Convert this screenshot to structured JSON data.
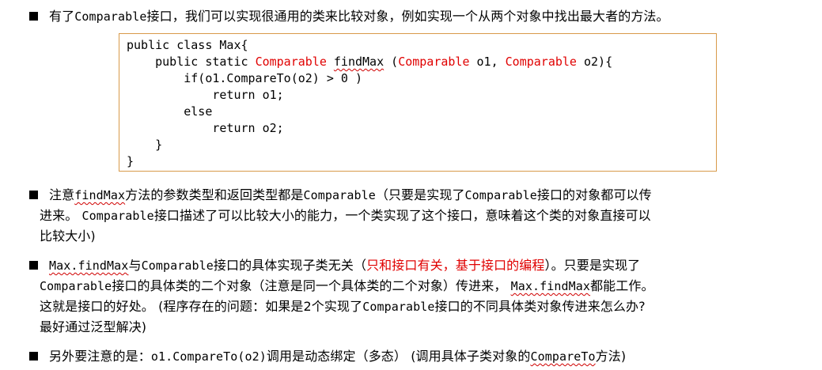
{
  "bullets": [
    {
      "line1_pre": "有了",
      "line1_code": "Comparable",
      "line1_post": "接口，我们可以实现很通用的类来比较对象，例如实现一个从两个对象中找出最大者的方法。"
    },
    {
      "line1_a": "注意",
      "line1_code1": "findMax",
      "line1_b": "方法的参数类型和返回类型都是",
      "line1_code2": "Comparable",
      "line1_c": "（只要是实现了",
      "line1_code3": "Comparable",
      "line1_d": "接口的对象都可以传",
      "line2_a": "进来。 ",
      "line2_code": "Comparable",
      "line2_b": "接口描述了可以比较大小的能力，一个类实现了这个接口，意味着这个类的对象直接可以",
      "line3": "比较大小)"
    },
    {
      "line1_code1": "Max.findMax",
      "line1_a": "与",
      "line1_code2": "Comparable",
      "line1_b": "接口的具体实现子类无关（",
      "line1_red": "只和接口有关，基于接口的编程",
      "line1_c": "）。只要是实现了",
      "line2_code1": "Comparable",
      "line2_a": "接口的具体类的二个对象（注意是同一个具体类的二个对象）传进来， ",
      "line2_code2": "Max.findMax",
      "line2_b": "都能工作。",
      "line3_a": "这就是接口的好处。 (程序存在的问题：如果是2个实现了",
      "line3_code": "Comparable",
      "line3_b": "接口的不同具体类对象传进来怎么办?",
      "line4": "最好通过泛型解决)"
    },
    {
      "line1_a": "另外要注意的是：",
      "line1_code1": "o1.CompareTo(o2)",
      "line1_b": "调用是动态绑定（多态） (调用具体子类对象的",
      "line1_code2": "CompareTo",
      "line1_c": "方法)"
    }
  ],
  "code": {
    "l1": "public class Max{",
    "l2_pre": "    public static ",
    "l2_type": "Comparable",
    "l2_sp": " ",
    "l2_name": "findMax",
    "l2_open": " (",
    "l2_t1": "Comparable",
    "l2_p1": " o1, ",
    "l2_t2": "Comparable",
    "l2_p2": " o2){",
    "l3": "        if(o1.CompareTo(o2) > 0 )",
    "l4": "            return o1;",
    "l5": "        else",
    "l6": "            return o2;",
    "l7": "    }",
    "l8": "}"
  },
  "colors": {
    "accent_red": "#e00000",
    "box_border": "#d89a4a"
  }
}
